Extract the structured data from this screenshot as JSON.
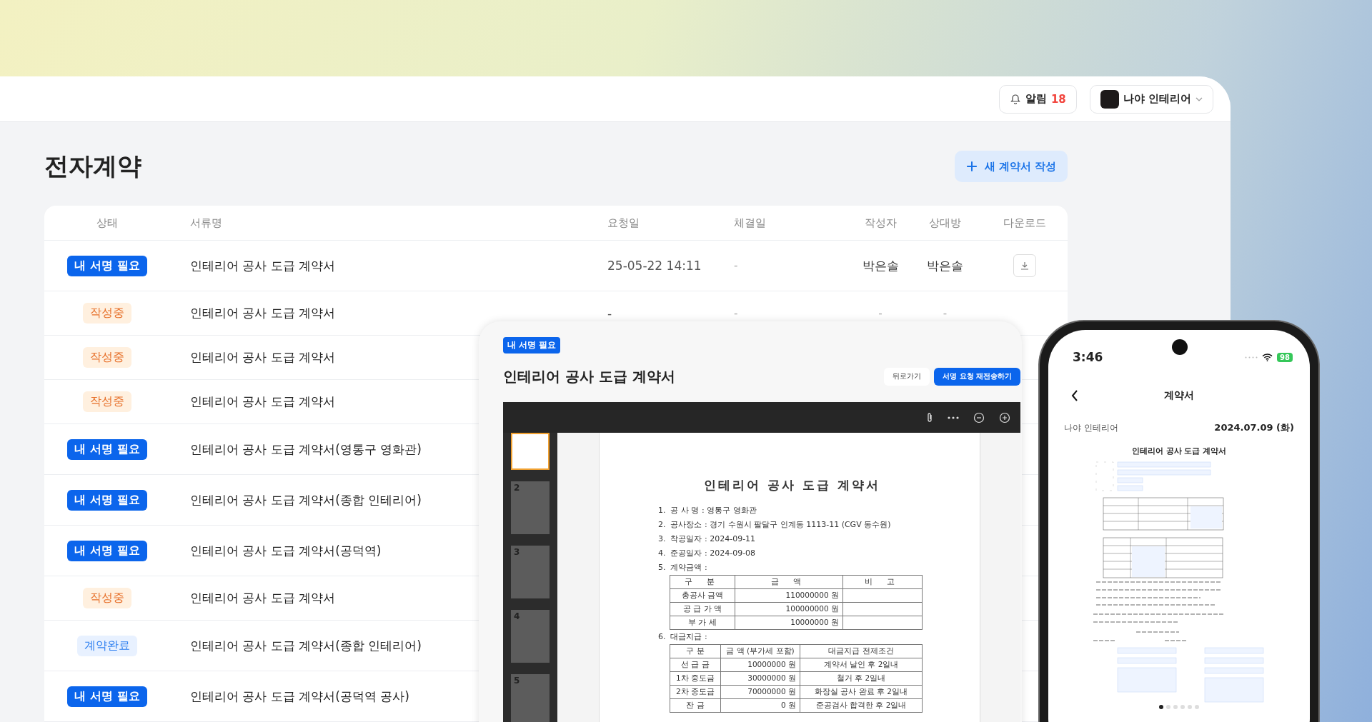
{
  "header": {
    "notification": {
      "label": "알림",
      "count": "18"
    },
    "account": {
      "name": "나야 인테리어"
    }
  },
  "page": {
    "title": "전자계약",
    "new_button": "새 계약서 작성"
  },
  "table": {
    "columns": [
      "상태",
      "서류명",
      "요청일",
      "체결일",
      "작성자",
      "상대방",
      "다운로드"
    ],
    "rows": [
      {
        "status": {
          "kind": "sign",
          "label": "내 서명 필요"
        },
        "name": "인테리어 공사 도급 계약서",
        "requested": "25-05-22 14:11",
        "signed": "-",
        "author": "박은솔",
        "counterparty": "박은솔",
        "download": true
      },
      {
        "status": {
          "kind": "draft",
          "label": "작성중"
        },
        "name": "인테리어 공사 도급 계약서",
        "requested": "-",
        "signed": "-",
        "author": "-",
        "counterparty": "-"
      },
      {
        "status": {
          "kind": "draft",
          "label": "작성중"
        },
        "name": "인테리어 공사 도급 계약서"
      },
      {
        "status": {
          "kind": "draft",
          "label": "작성중"
        },
        "name": "인테리어 공사 도급 계약서"
      },
      {
        "status": {
          "kind": "sign",
          "label": "내 서명 필요"
        },
        "name": "인테리어 공사 도급 계약서(영통구 영화관)"
      },
      {
        "status": {
          "kind": "sign",
          "label": "내 서명 필요"
        },
        "name": "인테리어 공사 도급 계약서(종합 인테리어)"
      },
      {
        "status": {
          "kind": "sign",
          "label": "내 서명 필요"
        },
        "name": "인테리어 공사 도급 계약서(공덕역)"
      },
      {
        "status": {
          "kind": "draft",
          "label": "작성중"
        },
        "name": "인테리어 공사 도급 계약서"
      },
      {
        "status": {
          "kind": "done",
          "label": "계약완료"
        },
        "name": "인테리어 공사 도급 계약서(종합 인테리어)"
      },
      {
        "status": {
          "kind": "sign",
          "label": "내 서명 필요"
        },
        "name": "인테리어 공사 도급 계약서(공덕역 공사)"
      }
    ]
  },
  "tablet": {
    "badge": "내 서명 필요",
    "title": "인테리어 공사 도급 계약서",
    "buttons": [
      {
        "kind": "secondary",
        "label": "뒤로가기"
      },
      {
        "kind": "primary",
        "label": "서명 요청 재전송하기"
      }
    ],
    "thumbnails": [
      {
        "selected": true
      },
      {
        "number": "2",
        "selected": false
      },
      {
        "number": "3",
        "selected": false
      },
      {
        "number": "4",
        "selected": false
      },
      {
        "number": "5",
        "selected": false
      }
    ],
    "document": {
      "title": "인테리어 공사 도급 계약서",
      "items": [
        {
          "no": "1.",
          "label": "공 사 명 :",
          "value": "영통구 영화관"
        },
        {
          "no": "2.",
          "label": "공사장소 :",
          "value": "경기 수원시 팔달구 인계동 1113-11 (CGV 동수원)"
        },
        {
          "no": "3.",
          "label": "착공일자 :",
          "value": "2024-09-11"
        },
        {
          "no": "4.",
          "label": "준공일자 :",
          "value": "2024-09-08"
        }
      ],
      "amount": {
        "no": "5.",
        "label": "계약금액 :",
        "columns": [
          "구 분",
          "금 액",
          "비 고"
        ],
        "rows": [
          {
            "item": "총공사 금액",
            "amount": "110000000 원"
          },
          {
            "item": "공 급 가 액",
            "amount": "100000000 원"
          },
          {
            "item": "부 가 세",
            "amount": "10000000 원"
          }
        ]
      },
      "payment": {
        "no": "6.",
        "label": "대금지급 :",
        "columns": [
          "구 분",
          "금 액 (부가세 포함)",
          "대금지급 전제조건"
        ],
        "rows": [
          {
            "item": "선 급 금",
            "amount": "10000000 원",
            "condition": "계약서 날인 후 2일내"
          },
          {
            "item": "1차 중도금",
            "amount": "30000000 원",
            "condition": "철거 후 2일내"
          },
          {
            "item": "2차 중도금",
            "amount": "70000000 원",
            "condition": "화장실 공사 완료 후 2일내"
          },
          {
            "item": "잔 금",
            "amount": "0 원",
            "condition": "준공검사 합격한 후 2일내"
          }
        ]
      }
    }
  },
  "phone": {
    "time": "3:46",
    "battery": "98",
    "title": "계약서",
    "company": "나야 인테리어",
    "date": "2024.07.09 (화)",
    "doc_title": "인테리어 공사 도급 계약서",
    "pages": [
      {
        "selected": true
      },
      {
        "selected": false
      },
      {
        "selected": false
      },
      {
        "selected": false
      },
      {
        "selected": false
      },
      {
        "selected": false
      }
    ]
  }
}
